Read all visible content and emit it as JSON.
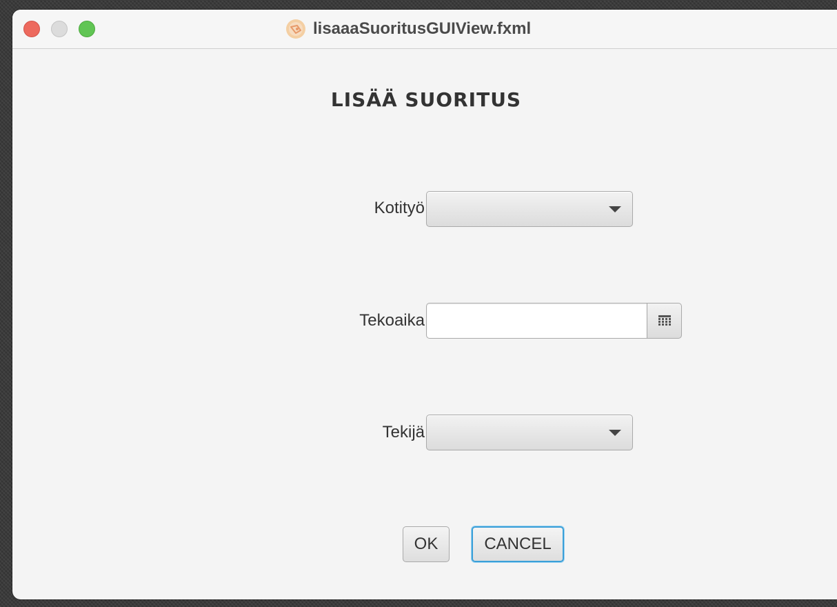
{
  "window": {
    "title": "lisaaaSuoritusGUIView.fxml"
  },
  "form": {
    "heading": "LISÄÄ SUORITUS",
    "fields": {
      "kotityo": {
        "label": "Kotityö",
        "value": ""
      },
      "tekoaika": {
        "label": "Tekoaika",
        "value": ""
      },
      "tekija": {
        "label": "Tekijä",
        "value": ""
      }
    },
    "buttons": {
      "ok": "OK",
      "cancel": "CANCEL"
    }
  },
  "icons": {
    "app": "app-icon",
    "dropdown": "chevron-down-icon",
    "date_picker": "calendar-icon"
  },
  "colors": {
    "focus_accent": "#3a9fd8",
    "close": "#ed6a5e",
    "minimize": "#dcdcdc",
    "maximize": "#61c554"
  }
}
